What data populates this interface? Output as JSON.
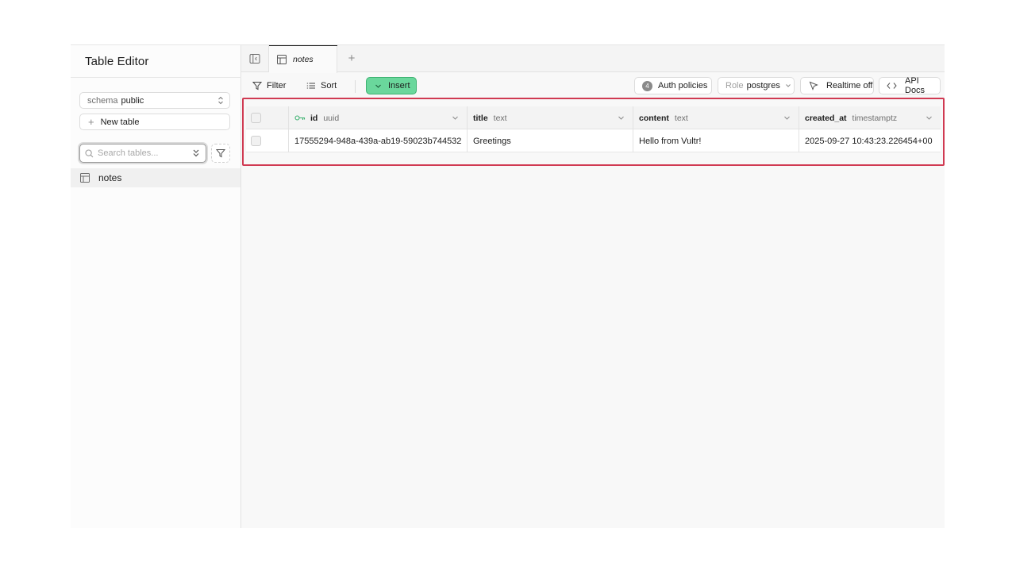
{
  "sidebar": {
    "title": "Table Editor",
    "schema_label": "schema",
    "schema_value": "public",
    "new_table_label": "New table",
    "search_placeholder": "Search tables...",
    "tables": [
      {
        "label": "notes"
      }
    ]
  },
  "tabs": [
    {
      "label": "notes",
      "active": true
    }
  ],
  "toolbar": {
    "filter_label": "Filter",
    "sort_label": "Sort",
    "insert_label": "Insert",
    "auth_badge": "4",
    "auth_label": "Auth policies",
    "role_label": "Role",
    "role_value": "postgres",
    "realtime_label": "Realtime off",
    "api_docs_label": "API Docs"
  },
  "grid": {
    "columns": [
      {
        "name": "id",
        "type": "uuid",
        "primary_key": true
      },
      {
        "name": "title",
        "type": "text"
      },
      {
        "name": "content",
        "type": "text"
      },
      {
        "name": "created_at",
        "type": "timestamptz"
      }
    ],
    "rows": [
      [
        "17555294-948a-439a-ab19-59023b744532",
        "Greetings",
        "Hello from Vultr!",
        "2025-09-27 10:43:23.226454+00"
      ]
    ]
  },
  "colors": {
    "accent_green": "#6ad79c",
    "highlight_red": "#d03a52"
  }
}
